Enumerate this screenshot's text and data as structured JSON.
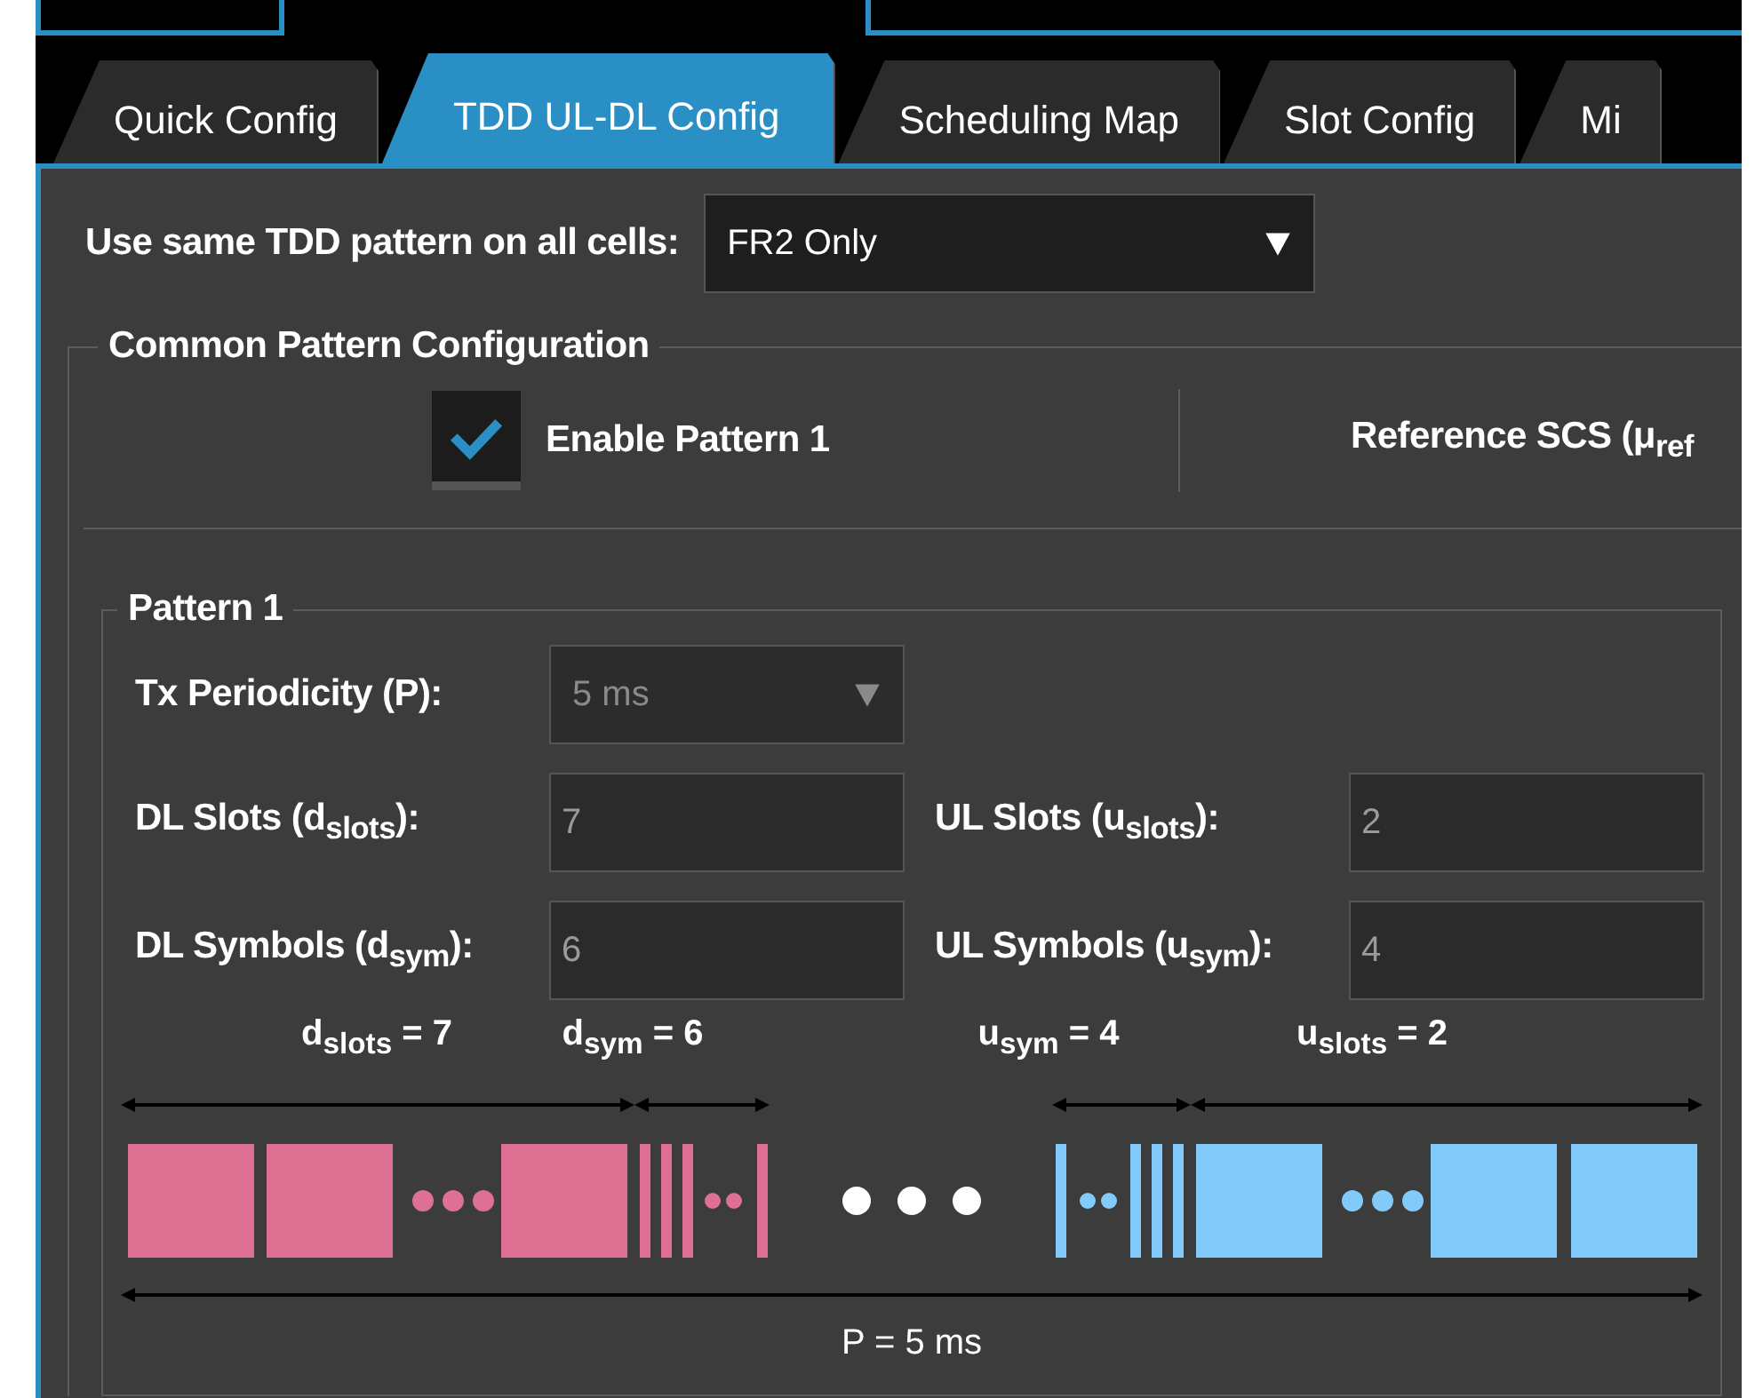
{
  "tabs": [
    {
      "label": "Quick Config",
      "selected": false
    },
    {
      "label": "TDD UL-DL Config",
      "selected": true
    },
    {
      "label": "Scheduling Map",
      "selected": false
    },
    {
      "label": "Slot Config",
      "selected": false
    },
    {
      "label": "Mi",
      "selected": false
    }
  ],
  "tdd_pattern": {
    "label": "Use same TDD pattern on all cells:",
    "value": "FR2 Only"
  },
  "common": {
    "title": "Common Pattern Configuration",
    "enable": {
      "label": "Enable Pattern 1",
      "checked": true
    },
    "reference_scs": {
      "label": "Reference SCS (μ$_{ref}$"
    }
  },
  "pattern": {
    "title": "Pattern 1",
    "periodicity": {
      "label": "Tx Periodicity (P):",
      "value": "5 ms",
      "disabled": true
    },
    "fields": [
      {
        "label": "DL Slots (d$_{slots}$):",
        "value": "7"
      },
      {
        "label": "UL Slots (u$_{slots}$):",
        "value": "2"
      },
      {
        "label": "DL Symbols (d$_{sym}$):",
        "value": "6"
      },
      {
        "label": "UL Symbols (u$_{sym}$):",
        "value": "4"
      }
    ],
    "diagram": {
      "labels": [
        "d$_{slots}$ = 7",
        "d$_{sym}$ = 6",
        "u$_{sym}$ = 4",
        "u$_{slots}$ = 2"
      ],
      "period": "P = 5 ms"
    }
  }
}
